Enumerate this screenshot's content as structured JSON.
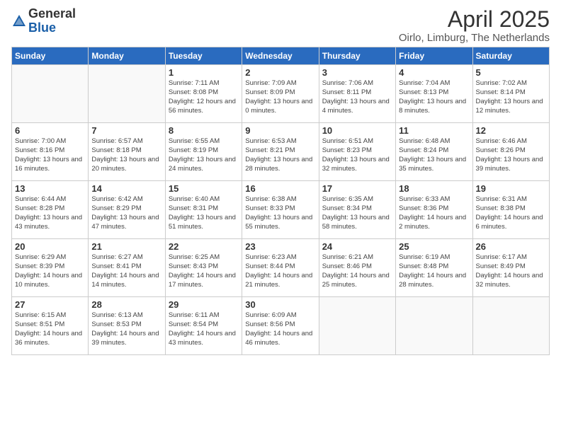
{
  "logo": {
    "general": "General",
    "blue": "Blue"
  },
  "title": "April 2025",
  "subtitle": "Oirlo, Limburg, The Netherlands",
  "days_header": [
    "Sunday",
    "Monday",
    "Tuesday",
    "Wednesday",
    "Thursday",
    "Friday",
    "Saturday"
  ],
  "weeks": [
    [
      {
        "day": "",
        "info": ""
      },
      {
        "day": "",
        "info": ""
      },
      {
        "day": "1",
        "info": "Sunrise: 7:11 AM\nSunset: 8:08 PM\nDaylight: 12 hours and 56 minutes."
      },
      {
        "day": "2",
        "info": "Sunrise: 7:09 AM\nSunset: 8:09 PM\nDaylight: 13 hours and 0 minutes."
      },
      {
        "day": "3",
        "info": "Sunrise: 7:06 AM\nSunset: 8:11 PM\nDaylight: 13 hours and 4 minutes."
      },
      {
        "day": "4",
        "info": "Sunrise: 7:04 AM\nSunset: 8:13 PM\nDaylight: 13 hours and 8 minutes."
      },
      {
        "day": "5",
        "info": "Sunrise: 7:02 AM\nSunset: 8:14 PM\nDaylight: 13 hours and 12 minutes."
      }
    ],
    [
      {
        "day": "6",
        "info": "Sunrise: 7:00 AM\nSunset: 8:16 PM\nDaylight: 13 hours and 16 minutes."
      },
      {
        "day": "7",
        "info": "Sunrise: 6:57 AM\nSunset: 8:18 PM\nDaylight: 13 hours and 20 minutes."
      },
      {
        "day": "8",
        "info": "Sunrise: 6:55 AM\nSunset: 8:19 PM\nDaylight: 13 hours and 24 minutes."
      },
      {
        "day": "9",
        "info": "Sunrise: 6:53 AM\nSunset: 8:21 PM\nDaylight: 13 hours and 28 minutes."
      },
      {
        "day": "10",
        "info": "Sunrise: 6:51 AM\nSunset: 8:23 PM\nDaylight: 13 hours and 32 minutes."
      },
      {
        "day": "11",
        "info": "Sunrise: 6:48 AM\nSunset: 8:24 PM\nDaylight: 13 hours and 35 minutes."
      },
      {
        "day": "12",
        "info": "Sunrise: 6:46 AM\nSunset: 8:26 PM\nDaylight: 13 hours and 39 minutes."
      }
    ],
    [
      {
        "day": "13",
        "info": "Sunrise: 6:44 AM\nSunset: 8:28 PM\nDaylight: 13 hours and 43 minutes."
      },
      {
        "day": "14",
        "info": "Sunrise: 6:42 AM\nSunset: 8:29 PM\nDaylight: 13 hours and 47 minutes."
      },
      {
        "day": "15",
        "info": "Sunrise: 6:40 AM\nSunset: 8:31 PM\nDaylight: 13 hours and 51 minutes."
      },
      {
        "day": "16",
        "info": "Sunrise: 6:38 AM\nSunset: 8:33 PM\nDaylight: 13 hours and 55 minutes."
      },
      {
        "day": "17",
        "info": "Sunrise: 6:35 AM\nSunset: 8:34 PM\nDaylight: 13 hours and 58 minutes."
      },
      {
        "day": "18",
        "info": "Sunrise: 6:33 AM\nSunset: 8:36 PM\nDaylight: 14 hours and 2 minutes."
      },
      {
        "day": "19",
        "info": "Sunrise: 6:31 AM\nSunset: 8:38 PM\nDaylight: 14 hours and 6 minutes."
      }
    ],
    [
      {
        "day": "20",
        "info": "Sunrise: 6:29 AM\nSunset: 8:39 PM\nDaylight: 14 hours and 10 minutes."
      },
      {
        "day": "21",
        "info": "Sunrise: 6:27 AM\nSunset: 8:41 PM\nDaylight: 14 hours and 14 minutes."
      },
      {
        "day": "22",
        "info": "Sunrise: 6:25 AM\nSunset: 8:43 PM\nDaylight: 14 hours and 17 minutes."
      },
      {
        "day": "23",
        "info": "Sunrise: 6:23 AM\nSunset: 8:44 PM\nDaylight: 14 hours and 21 minutes."
      },
      {
        "day": "24",
        "info": "Sunrise: 6:21 AM\nSunset: 8:46 PM\nDaylight: 14 hours and 25 minutes."
      },
      {
        "day": "25",
        "info": "Sunrise: 6:19 AM\nSunset: 8:48 PM\nDaylight: 14 hours and 28 minutes."
      },
      {
        "day": "26",
        "info": "Sunrise: 6:17 AM\nSunset: 8:49 PM\nDaylight: 14 hours and 32 minutes."
      }
    ],
    [
      {
        "day": "27",
        "info": "Sunrise: 6:15 AM\nSunset: 8:51 PM\nDaylight: 14 hours and 36 minutes."
      },
      {
        "day": "28",
        "info": "Sunrise: 6:13 AM\nSunset: 8:53 PM\nDaylight: 14 hours and 39 minutes."
      },
      {
        "day": "29",
        "info": "Sunrise: 6:11 AM\nSunset: 8:54 PM\nDaylight: 14 hours and 43 minutes."
      },
      {
        "day": "30",
        "info": "Sunrise: 6:09 AM\nSunset: 8:56 PM\nDaylight: 14 hours and 46 minutes."
      },
      {
        "day": "",
        "info": ""
      },
      {
        "day": "",
        "info": ""
      },
      {
        "day": "",
        "info": ""
      }
    ]
  ]
}
